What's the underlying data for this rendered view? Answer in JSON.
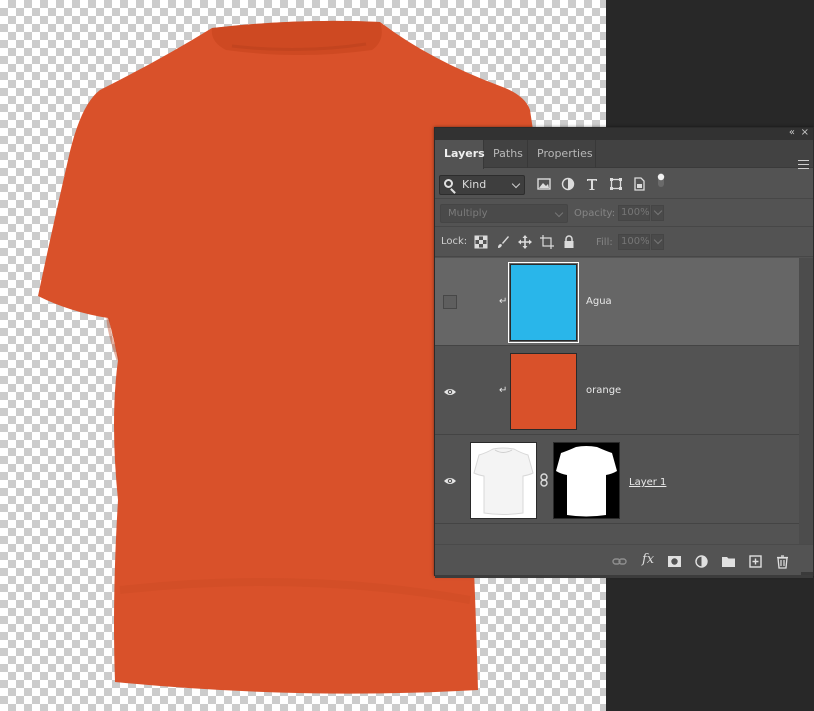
{
  "panel": {
    "collapse_glyph": "«",
    "close_glyph": "×",
    "tabs": [
      {
        "label": "Layers",
        "active": true
      },
      {
        "label": "Paths",
        "active": false
      },
      {
        "label": "Properties",
        "active": false
      }
    ],
    "menu_icon": "hamburger-menu-icon"
  },
  "filter": {
    "kind_label": "Kind",
    "icons": [
      "pixel-layer-filter-icon",
      "adjustment-layer-filter-icon",
      "type-layer-filter-icon",
      "shape-layer-filter-icon",
      "smart-object-filter-icon",
      "filter-toggle-icon"
    ]
  },
  "blend": {
    "mode": "Multiply",
    "opacity_label": "Opacity:",
    "opacity_value": "100%",
    "fill_label": "Fill:",
    "fill_value": "100%"
  },
  "lock": {
    "label": "Lock:",
    "icons": [
      "lock-transparent-pixels-icon",
      "lock-image-pixels-icon",
      "lock-position-icon",
      "lock-artboard-icon",
      "lock-all-icon"
    ]
  },
  "layers": [
    {
      "name": "Agua",
      "visible": false,
      "selected": true,
      "clipped": true,
      "color": "#29b6ea"
    },
    {
      "name": "orange",
      "visible": true,
      "selected": false,
      "clipped": true,
      "color": "#d9512a"
    },
    {
      "name": "Layer 1",
      "visible": true,
      "selected": false,
      "clipped": false,
      "has_mask": true
    }
  ],
  "bottom_bar": {
    "icons": [
      "link-layers-icon",
      "fx-icon",
      "add-mask-icon",
      "adjustment-layer-icon",
      "group-folder-icon",
      "new-layer-icon",
      "trash-icon"
    ],
    "fx_label": "fx"
  },
  "canvas": {
    "shirt_color": "#d9512a"
  }
}
